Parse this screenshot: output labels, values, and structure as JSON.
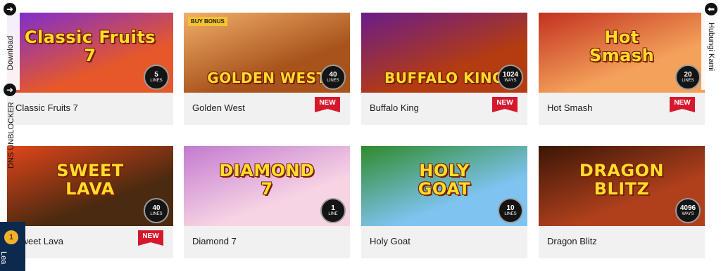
{
  "side_left": {
    "download_label": "Download",
    "dns_label": "DNS UNBLOCKER"
  },
  "side_right": {
    "contact_label": "Hubungi Kami"
  },
  "leaderboard": {
    "label": "Lea",
    "medal": "1"
  },
  "games": [
    {
      "name": "Classic Fruits 7",
      "art_title": "Classic Fruits\n7",
      "lines_value": "5",
      "lines_unit": "LINES",
      "is_new": false,
      "new_label": "",
      "bg": "#e6582a",
      "bg2": "#7a2bd6"
    },
    {
      "name": "Golden West",
      "art_title": "GOLDEN WEST",
      "lines_value": "40",
      "lines_unit": "LINES",
      "is_new": true,
      "new_label": "NEW",
      "bg": "#a8521c",
      "bg2": "#f0b06a",
      "buy_bonus": "BUY BONUS"
    },
    {
      "name": "Buffalo King",
      "art_title": "BUFFALO KING",
      "lines_value": "1024",
      "lines_unit": "WAYS",
      "is_new": true,
      "new_label": "NEW",
      "bg": "#b43c10",
      "bg2": "#6a1c8a"
    },
    {
      "name": "Hot Smash",
      "art_title": "Hot\nSmash",
      "lines_value": "20",
      "lines_unit": "LINES",
      "is_new": true,
      "new_label": "NEW",
      "bg": "#f4a15a",
      "bg2": "#c2311f"
    },
    {
      "name": "Sweet Lava",
      "art_title": "SWEET\nLAVA",
      "lines_value": "40",
      "lines_unit": "LINES",
      "is_new": true,
      "new_label": "NEW",
      "bg": "#4a2a10",
      "bg2": "#e0451a"
    },
    {
      "name": "Diamond 7",
      "art_title": "DIAMOND\n7",
      "lines_value": "1",
      "lines_unit": "LINE",
      "is_new": false,
      "new_label": "",
      "bg": "#f7d4e4",
      "bg2": "#c37ad0"
    },
    {
      "name": "Holy Goat",
      "art_title": "HOLY\nGOAT",
      "lines_value": "10",
      "lines_unit": "LINES",
      "is_new": false,
      "new_label": "",
      "bg": "#7fc3f0",
      "bg2": "#2f8a2a"
    },
    {
      "name": "Dragon Blitz",
      "art_title": "DRAGON\nBLITZ",
      "lines_value": "4096",
      "lines_unit": "WAYS",
      "is_new": false,
      "new_label": "",
      "bg": "#b0401c",
      "bg2": "#3a1606"
    }
  ]
}
